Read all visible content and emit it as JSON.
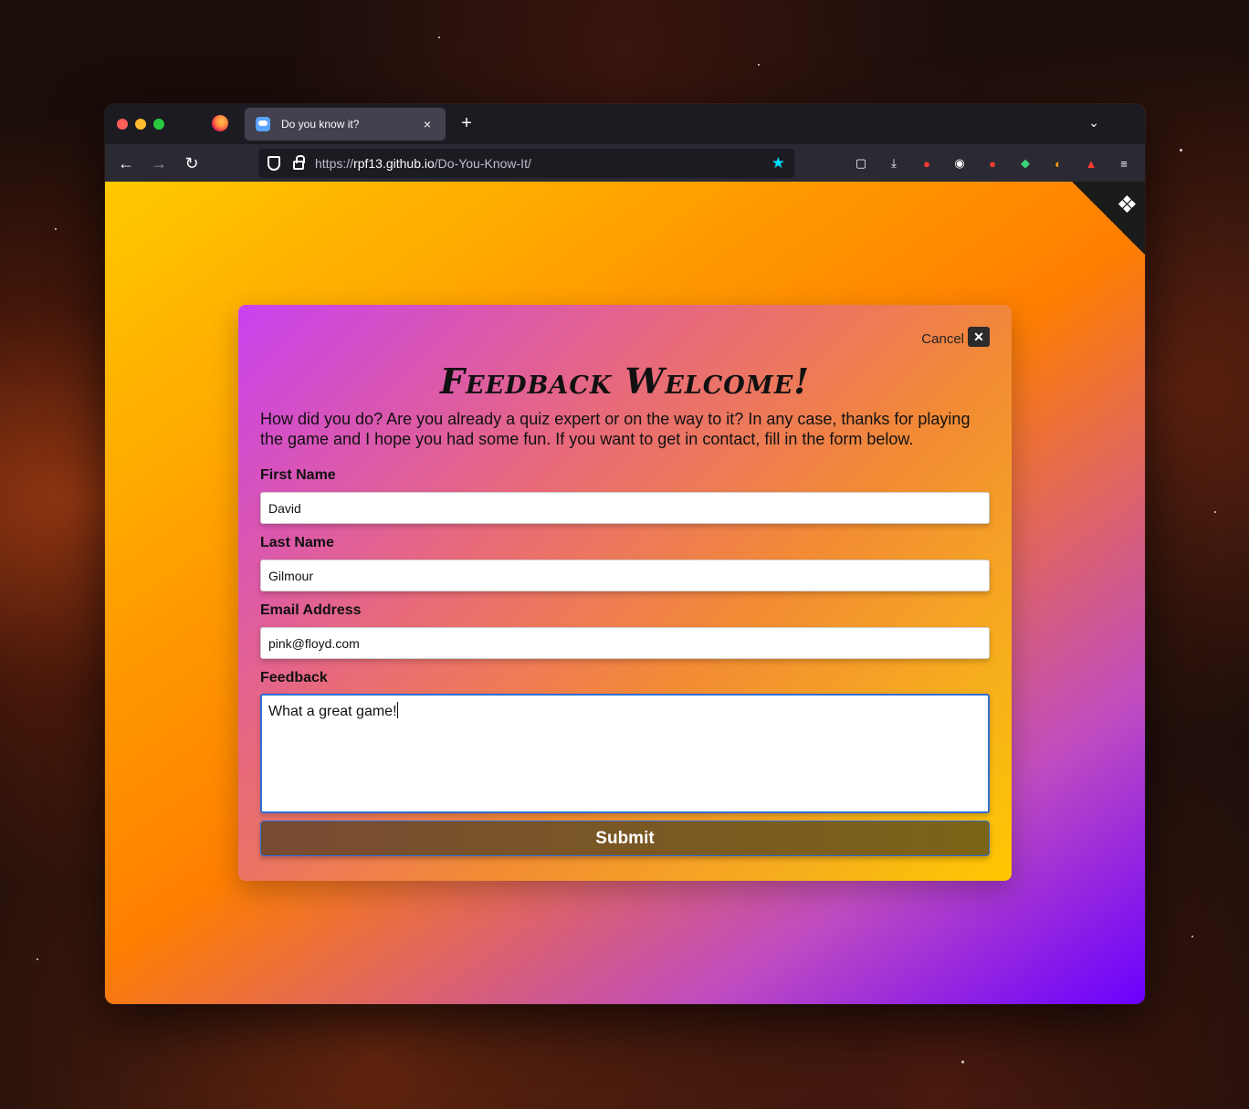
{
  "browser": {
    "tab_title": "Do you know it?",
    "tab_close": "×",
    "new_tab": "+",
    "tab_list": "⌄",
    "url_scheme": "https://",
    "url_host": "rpf13.github.io",
    "url_path": "/Do-You-Know-It/",
    "bookmark_star": "★"
  },
  "nav": {
    "back": "←",
    "forward": "→",
    "reload": "↻"
  },
  "toolbar_icons": [
    "pocket-icon",
    "download-icon",
    "extension-icon",
    "extension-icon",
    "extension-icon",
    "shield-extension-icon",
    "extension-icon",
    "extension-icon",
    "menu-icon"
  ],
  "card": {
    "cancel_label": "Cancel",
    "cancel_icon": "✕",
    "title": "Feedback Welcome!",
    "intro": "How did you do? Are you already a quiz expert or on the way to it? In any case, thanks for playing the game and I hope you had some fun. If you want to get in contact, fill in the form below.",
    "fields": {
      "first_name_label": "First Name",
      "first_name_value": "David",
      "last_name_label": "Last Name",
      "last_name_value": "Gilmour",
      "email_label": "Email Address",
      "email_value": "pink@floyd.com",
      "feedback_label": "Feedback",
      "feedback_value": "What a great game!"
    },
    "submit_label": "Submit"
  },
  "colors": {
    "gradient_start": "#ffc800",
    "gradient_mid": "#ff7f00",
    "gradient_end": "#6a00ff",
    "card_start": "#c941f0",
    "card_end": "#ffc800",
    "focus_blue": "#2f6fd6",
    "url_star": "#00ddff"
  }
}
